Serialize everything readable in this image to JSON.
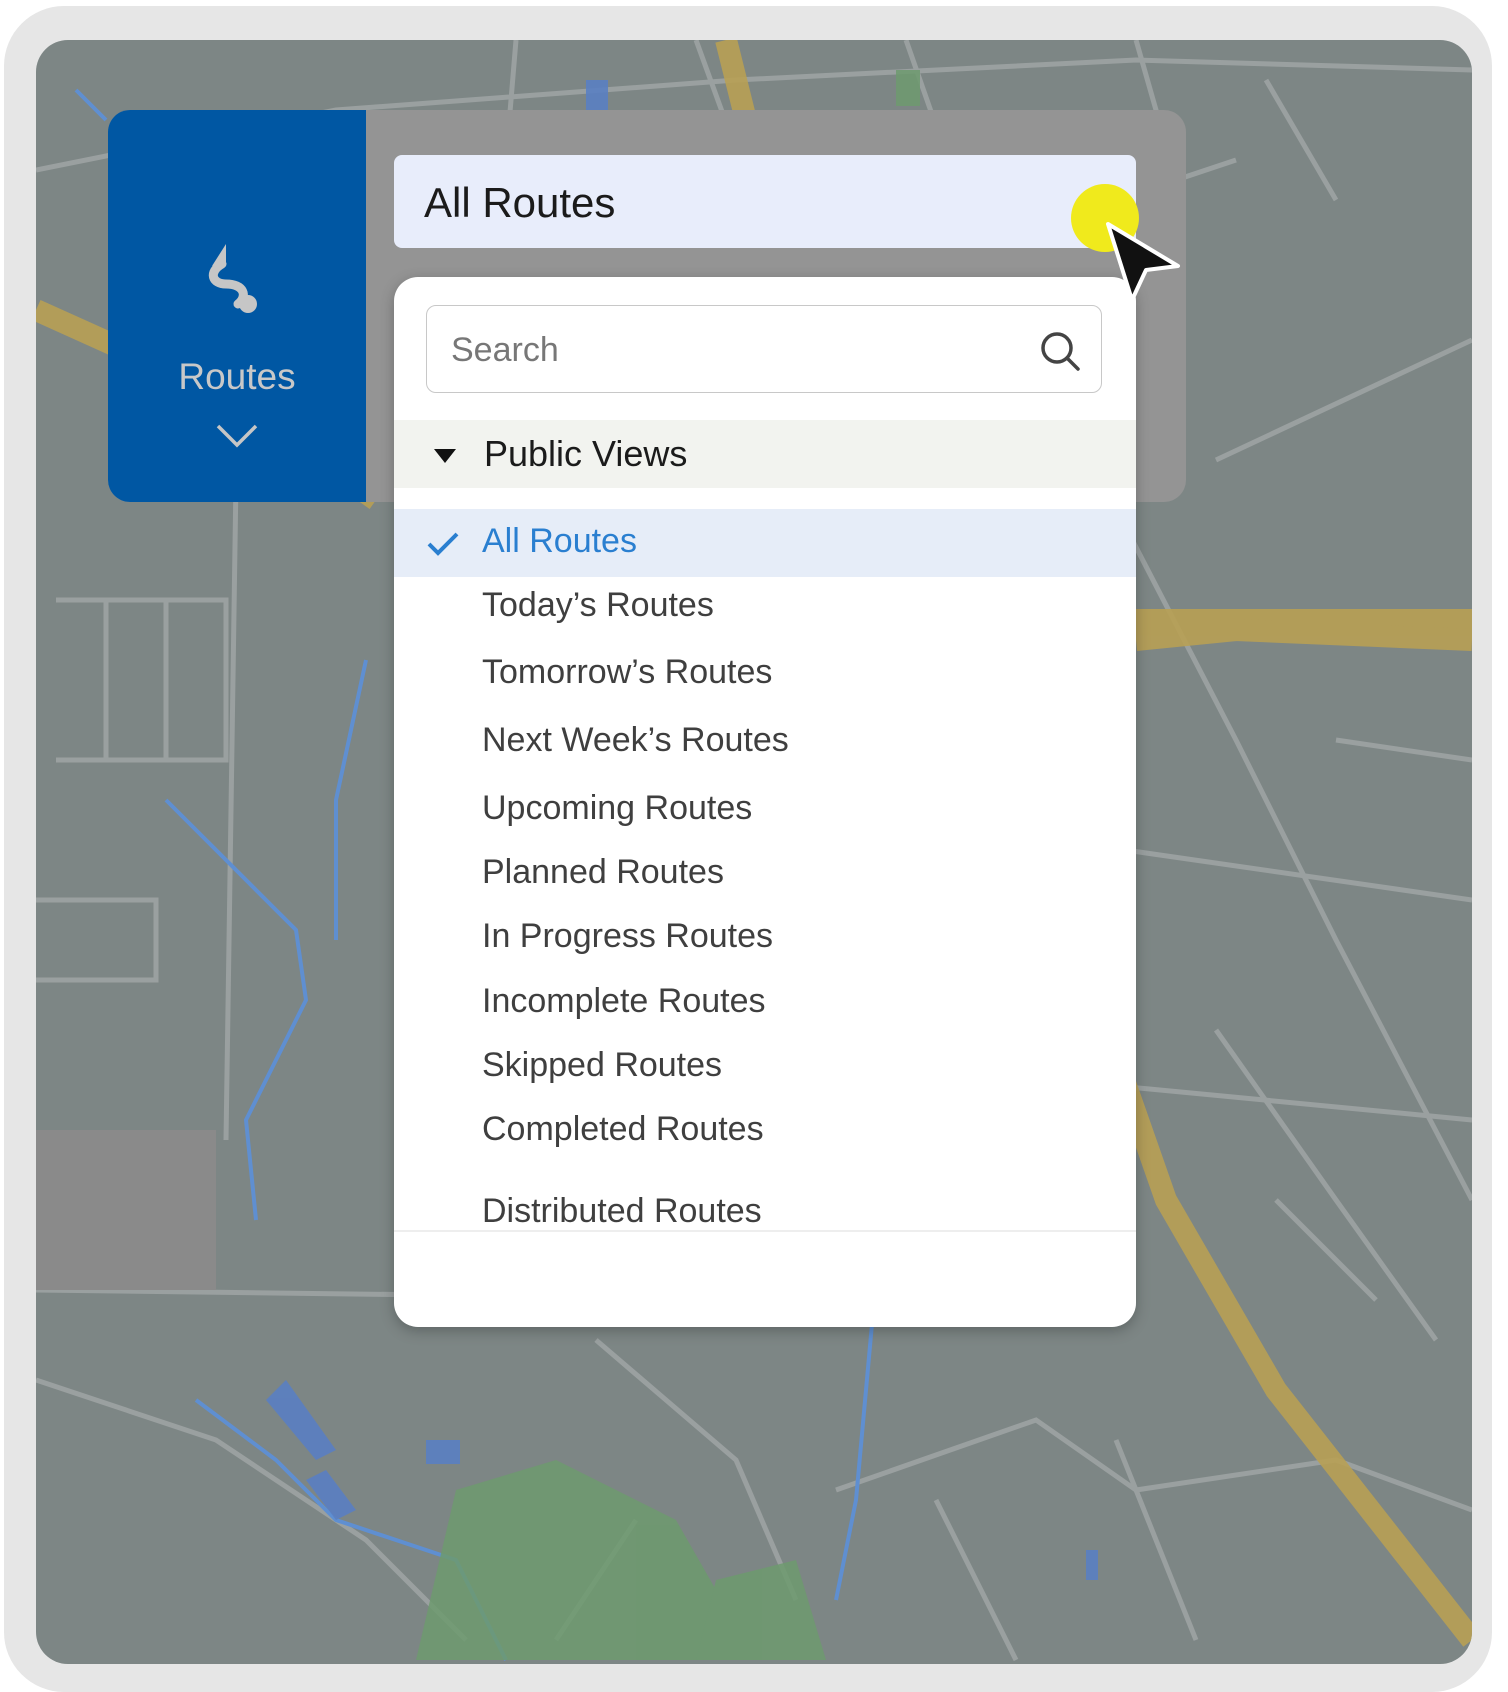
{
  "app": {
    "tile_label": "Routes",
    "tile_icon": "route-icon",
    "tile_chevron": "chevron-down-icon",
    "tile_color": "#0057a3"
  },
  "view_selector": {
    "value": "All Routes",
    "arrow_icon": "chevron-down-icon"
  },
  "dropdown": {
    "search_placeholder": "Search",
    "search_icon": "search-icon",
    "group_label": "Public Views",
    "items": [
      {
        "label": "All Routes",
        "selected": true
      },
      {
        "label": "Today’s Routes",
        "selected": false
      },
      {
        "label": "Tomorrow’s Routes",
        "selected": false
      },
      {
        "label": "Next Week’s Routes",
        "selected": false
      },
      {
        "label": "Upcoming Routes",
        "selected": false
      },
      {
        "label": "Planned Routes",
        "selected": false
      },
      {
        "label": "In Progress Routes",
        "selected": false
      },
      {
        "label": "Incomplete Routes",
        "selected": false
      },
      {
        "label": "Skipped Routes",
        "selected": false
      },
      {
        "label": "Completed Routes",
        "selected": false
      },
      {
        "label": "Distributed Routes",
        "selected": false
      }
    ],
    "selected_color": "#2a7fd0"
  }
}
